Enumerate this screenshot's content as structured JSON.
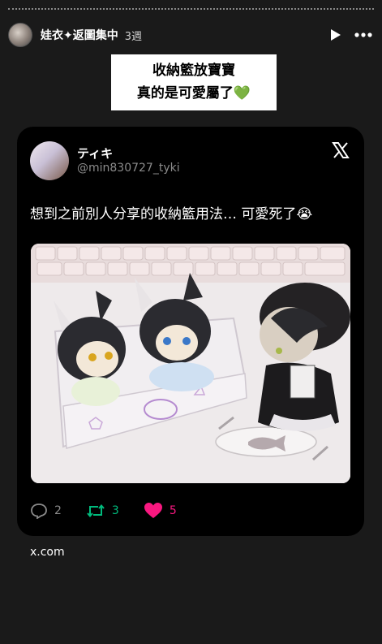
{
  "story": {
    "account": "娃衣✦返圖集中",
    "age": "3週",
    "caption_line1": "收納籃放寶寶",
    "caption_line2": "真的是可愛屬了💚"
  },
  "post": {
    "display_name": "ティキ",
    "handle": "@min830727_tyki",
    "text": "想到之前別人分享的收納籃用法… 可愛死了😭",
    "replies": "2",
    "reposts": "3",
    "likes": "5",
    "source": "x.com"
  },
  "colors": {
    "repost": "#00ba7c",
    "like": "#f91880",
    "muted": "#8b8b8b"
  }
}
